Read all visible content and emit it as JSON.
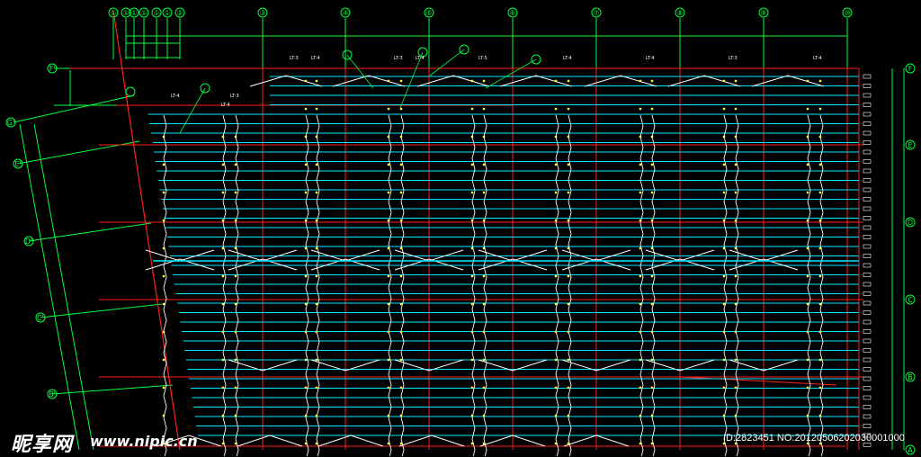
{
  "colors": {
    "background": "#000000",
    "axis_line": "#ff2020",
    "dimension": "#00ff40",
    "purlin": "#00e8ff",
    "truss": "#ffffff",
    "bolt": "#ffff40"
  },
  "axes": {
    "top": [
      "①",
      "①",
      "①",
      "①",
      "①",
      "①",
      "②",
      "③",
      "④",
      "⑤",
      "⑥",
      "⑦",
      "⑧",
      "⑨",
      "⑩"
    ],
    "right": [
      "F",
      "E",
      "D",
      "C",
      "B",
      "A"
    ],
    "left": [
      "F'",
      "G'",
      "E'",
      "D'",
      "C'",
      "B'"
    ]
  },
  "member_labels": [
    "LT-3",
    "LT-4",
    "LT-3",
    "LT-4",
    "LT-5",
    "LT-4",
    "LT-4",
    "LT-3",
    "LT-4",
    "LT-4",
    "LT-3",
    "LT-4"
  ],
  "watermark": {
    "logo": "昵享网",
    "url": "www.nipic.cn",
    "id_text": "ID:2823451 NO:20120506202030001000"
  }
}
